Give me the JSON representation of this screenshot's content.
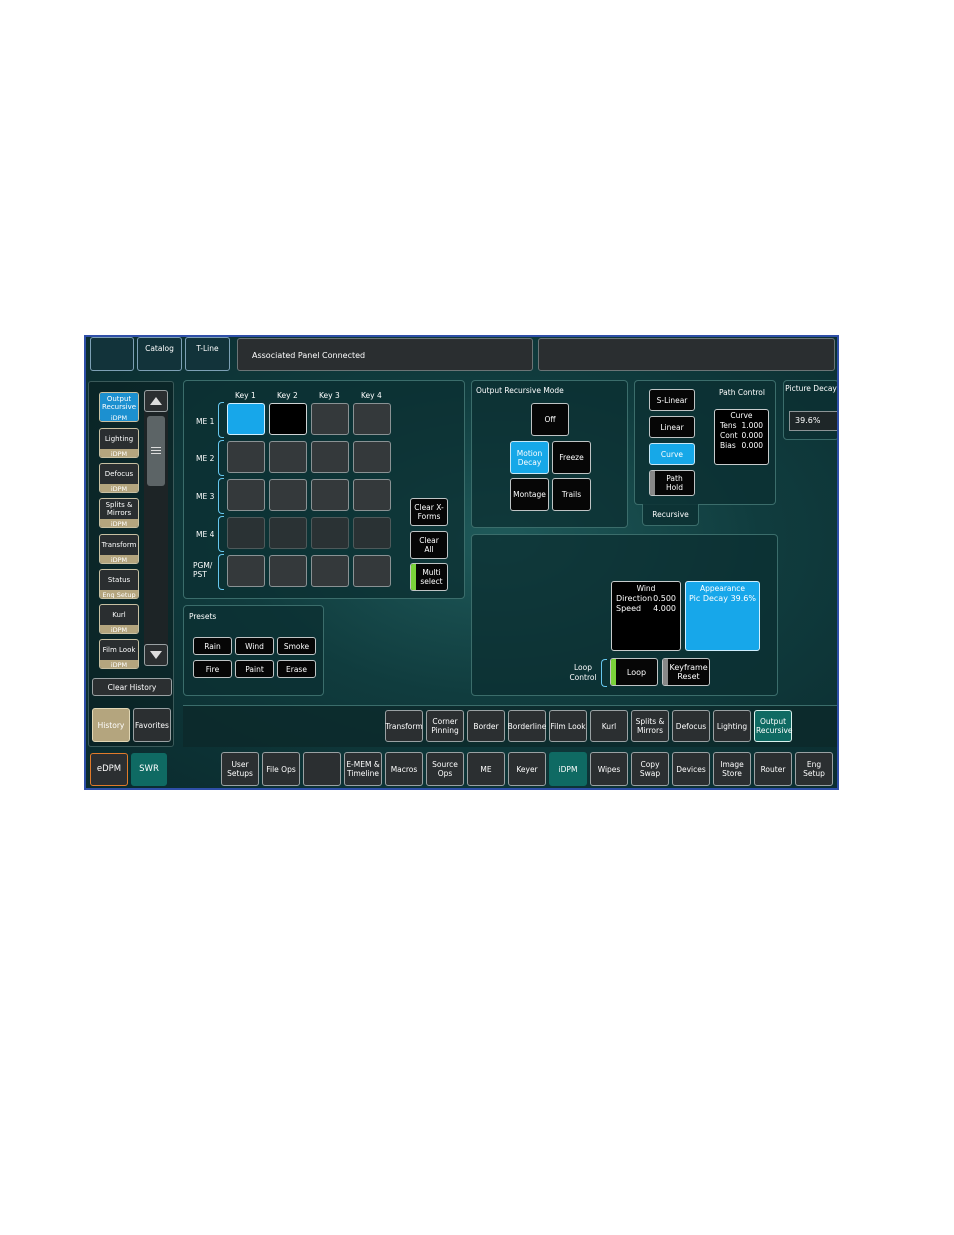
{
  "top_bar": {
    "tab_blank": "",
    "tab_catalog": "Catalog",
    "tab_tline": "T-Line",
    "status": "Associated Panel Connected",
    "status_right": ""
  },
  "history": {
    "items": [
      {
        "title": "Output Recursive",
        "sub": "iDPM"
      },
      {
        "title": "Lighting",
        "sub": "iDPM"
      },
      {
        "title": "Defocus",
        "sub": "iDPM"
      },
      {
        "title": "Splits & Mirrors",
        "sub": "iDPM"
      },
      {
        "title": "Transform",
        "sub": "iDPM"
      },
      {
        "title": "Status",
        "sub": "Eng Setup"
      },
      {
        "title": "Kurl",
        "sub": "iDPM"
      },
      {
        "title": "Film Look",
        "sub": "iDPM"
      }
    ],
    "clear_label": "Clear History",
    "history_tab": "History",
    "favorites_tab": "Favorites",
    "edpm": "eDPM",
    "swr": "SWR"
  },
  "key_grid": {
    "columns": [
      "Key 1",
      "Key 2",
      "Key 3",
      "Key 4"
    ],
    "rows": [
      "ME 1",
      "ME 2",
      "ME 3",
      "ME 4",
      "PGM/ PST"
    ],
    "clear_xforms": "Clear X-Forms",
    "clear_all": "Clear All",
    "multi_select": "Multi select"
  },
  "presets": {
    "title": "Presets",
    "buttons": [
      "Rain",
      "Wind",
      "Smoke",
      "Fire",
      "Paint",
      "Erase"
    ]
  },
  "output_mode": {
    "title": "Output Recursive Mode",
    "off": "Off",
    "motion_decay": "Motion Decay",
    "freeze": "Freeze",
    "montage": "Montage",
    "trails": "Trails"
  },
  "path": {
    "title": "Path Control",
    "s_linear": "S-Linear",
    "linear": "Linear",
    "curve": "Curve",
    "path_hold": "Path Hold",
    "recursive_tab": "Recursive",
    "readout_title": "Curve",
    "tens_label": "Tens",
    "tens_value": "1.000",
    "cont_label": "Cont",
    "cont_value": "0.000",
    "bias_label": "Bias",
    "bias_value": "0.000"
  },
  "picture_decay": {
    "title": "Picture Decay",
    "value": "39.6%"
  },
  "wind": {
    "title": "Wind",
    "direction_label": "Direction",
    "direction_value": "0.500",
    "speed_label": "Speed",
    "speed_value": "4.000"
  },
  "appearance": {
    "title": "Appearance",
    "label": "Pic Decay",
    "value": "39.6%"
  },
  "loop": {
    "label": "Loop Control",
    "loop": "Loop",
    "keyframe_reset": "Keyframe Reset"
  },
  "sub_menu": [
    "Transform",
    "Corner Pinning",
    "Border",
    "Borderline",
    "Film Look",
    "Kurl",
    "Splits & Mirrors",
    "Defocus",
    "Lighting",
    "Output Recursive"
  ],
  "main_menu": [
    "User Setups",
    "File Ops",
    "",
    "E-MEM & Timeline",
    "Macros",
    "Source Ops",
    "ME",
    "Keyer",
    "iDPM",
    "Wipes",
    "Copy Swap",
    "Devices",
    "Image Store",
    "Router",
    "Eng Setup"
  ]
}
